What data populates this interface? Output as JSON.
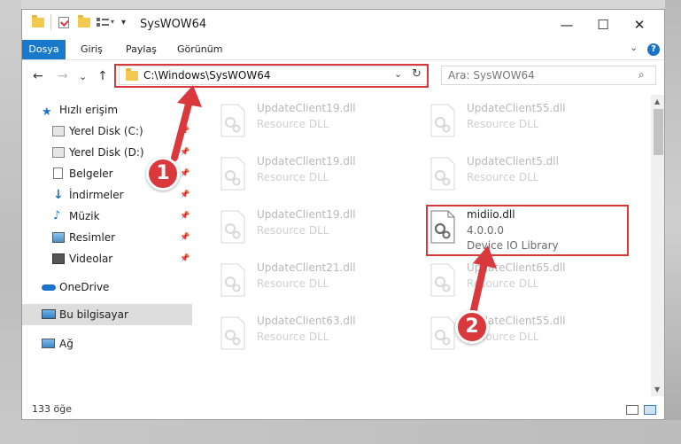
{
  "window": {
    "title": "SysWOW64"
  },
  "window_controls": {
    "minimize": "—",
    "maximize": "☐",
    "close": "✕"
  },
  "ribbon": {
    "tabs": [
      "Dosya",
      "Giriş",
      "Paylaş",
      "Görünüm"
    ],
    "help": "?",
    "collapse": "⌄"
  },
  "nav": {
    "back": "←",
    "forward": "→",
    "recent": "⌄",
    "up": "↑",
    "address": "C:\\Windows\\SysWOW64",
    "address_dropdown": "⌄",
    "refresh": "↻",
    "search_placeholder": "Ara: SysWOW64",
    "search_icon": "⌕"
  },
  "sidebar": {
    "items": [
      {
        "label": "Hızlı erişim",
        "icon": "star-icon"
      },
      {
        "label": "Yerel Disk (C:)",
        "icon": "drive-icon",
        "pinned": true
      },
      {
        "label": "Yerel Disk (D:)",
        "icon": "drive-icon",
        "pinned": true
      },
      {
        "label": "Belgeler",
        "icon": "documents-icon",
        "pinned": true
      },
      {
        "label": "İndirmeler",
        "icon": "download-icon",
        "pinned": true
      },
      {
        "label": "Müzik",
        "icon": "music-icon",
        "pinned": true
      },
      {
        "label": "Resimler",
        "icon": "pictures-icon",
        "pinned": true
      },
      {
        "label": "Videolar",
        "icon": "videos-icon",
        "pinned": true
      },
      {
        "label": "OneDrive",
        "icon": "cloud-icon"
      },
      {
        "label": "Bu bilgisayar",
        "icon": "computer-icon",
        "selected": true
      },
      {
        "label": "Ağ",
        "icon": "network-icon"
      }
    ]
  },
  "files": [
    {
      "name": "UpdateClient19.dll",
      "type": "Resource DLL",
      "ghost": true
    },
    {
      "name": "UpdateClient55.dll",
      "type": "Resource DLL",
      "ghost": true
    },
    {
      "name": "UpdateClient19.dll",
      "type": "Resource DLL",
      "ghost": true
    },
    {
      "name": "UpdateClient5.dll",
      "type": "Resource DLL",
      "ghost": true
    },
    {
      "name": "UpdateClient19.dll",
      "type": "Resource DLL",
      "ghost": true
    },
    {
      "name": "midiio.dll",
      "version": "4.0.0.0",
      "type": "Device IO Library",
      "ghost": false
    },
    {
      "name": "UpdateClient21.dll",
      "type": "Resource DLL",
      "ghost": true
    },
    {
      "name": "UpdateClient65.dll",
      "type": "Resource DLL",
      "ghost": true
    },
    {
      "name": "UpdateClient63.dll",
      "type": "Resource DLL",
      "ghost": true
    },
    {
      "name": "UpdateClient55.dll",
      "type": "Resource DLL",
      "ghost": true
    }
  ],
  "status": {
    "count": "133 öğe"
  },
  "callouts": {
    "step1": "1",
    "step2": "2"
  },
  "colors": {
    "accent": "#1979ca",
    "highlight": "#d9383c",
    "folder": "#f2c94c"
  }
}
